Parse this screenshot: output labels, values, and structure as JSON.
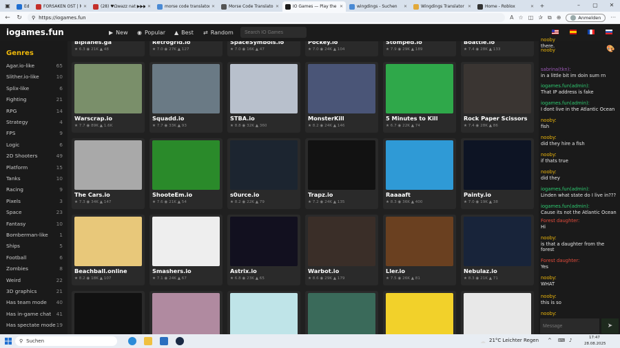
{
  "browser": {
    "tabs": [
      {
        "label": "Edge",
        "color": "#1f6fd1"
      },
      {
        "label": "FORSAKEN OST | M!:",
        "color": "#c4302b"
      },
      {
        "label": "(28) ♥Ωwazz nat ▶▶▶▶",
        "color": "#c4302b"
      },
      {
        "label": "morse code translator - S",
        "color": "#4a8ad4"
      },
      {
        "label": "Morse Code Translator | M",
        "color": "#555"
      },
      {
        "label": "IO Games — Play the Best",
        "color": "#1b1b1b"
      },
      {
        "label": "wingdings - Suchen",
        "color": "#4a8ad4"
      },
      {
        "label": "Wingdings Translator ⚙✍",
        "color": "#e2a93b"
      },
      {
        "label": "Home - Roblox",
        "color": "#333"
      }
    ],
    "url": "https://iogames.fun",
    "profile_label": "Anmelden"
  },
  "header": {
    "logo": "iogames.fun",
    "nav": [
      "New",
      "Popular",
      "Best",
      "Random"
    ],
    "search_placeholder": "Search IO Games"
  },
  "sidebar": {
    "title": "Genres",
    "categories": [
      {
        "name": "Agar.io-like",
        "count": "65"
      },
      {
        "name": "Slither.io-like",
        "count": "10"
      },
      {
        "name": "Splix-like",
        "count": "6"
      },
      {
        "name": "Fighting",
        "count": "21"
      },
      {
        "name": "RPG",
        "count": "14"
      },
      {
        "name": "Strategy",
        "count": "4"
      },
      {
        "name": "FPS",
        "count": "9"
      },
      {
        "name": "Logic",
        "count": "6"
      },
      {
        "name": "2D Shooters",
        "count": "49"
      },
      {
        "name": "Platform",
        "count": "15"
      },
      {
        "name": "Tanks",
        "count": "10"
      },
      {
        "name": "Racing",
        "count": "9"
      },
      {
        "name": "Pixels",
        "count": "3"
      },
      {
        "name": "Space",
        "count": "23"
      },
      {
        "name": "Fantasy",
        "count": "10"
      },
      {
        "name": "Bomberman-like",
        "count": "1"
      },
      {
        "name": "Ships",
        "count": "5"
      },
      {
        "name": "Football",
        "count": "6"
      },
      {
        "name": "Zombies",
        "count": "8"
      },
      {
        "name": "Weird",
        "count": "22"
      },
      {
        "name": "3D graphics",
        "count": "21"
      },
      {
        "name": "Has team mode",
        "count": "40"
      },
      {
        "name": "Has in-game chat",
        "count": "41"
      },
      {
        "name": "Has spectate mode",
        "count": "19"
      }
    ]
  },
  "games": [
    {
      "name": "Biplanes.ga",
      "rating": "6.3",
      "plays": "21K",
      "likes": "48",
      "color": "#6a8a9a"
    },
    {
      "name": "Retrogrid.io",
      "rating": "7.0",
      "plays": "27K",
      "likes": "127",
      "color": "#444"
    },
    {
      "name": "SpaceSymbols.io",
      "rating": "7.0",
      "plays": "16K",
      "likes": "47",
      "color": "#222"
    },
    {
      "name": "Pockey.io",
      "rating": "7.0",
      "plays": "24K",
      "likes": "104",
      "color": "#333"
    },
    {
      "name": "Stomped.io",
      "rating": "7.9",
      "plays": "29K",
      "likes": "189",
      "color": "#3a5"
    },
    {
      "name": "Boattle.io",
      "rating": "7.4",
      "plays": "28K",
      "likes": "133",
      "color": "#246"
    },
    {
      "name": "Warscrap.io",
      "rating": "7.7",
      "plays": "89K",
      "likes": "1.6K",
      "color": "#7a8f6a"
    },
    {
      "name": "Squadd.io",
      "rating": "7.7",
      "plays": "33K",
      "likes": "93",
      "color": "#6a7a85"
    },
    {
      "name": "STBA.io",
      "rating": "8.8",
      "plays": "32K",
      "likes": "360",
      "color": "#b8c0cc"
    },
    {
      "name": "MonsterKill",
      "rating": "8.2",
      "plays": "24K",
      "likes": "146",
      "color": "#4a5577"
    },
    {
      "name": "5 Minutes to Kill",
      "rating": "6.7",
      "plays": "22K",
      "likes": "74",
      "color": "#2fa84a"
    },
    {
      "name": "Rock Paper Scissors",
      "rating": "7.4",
      "plays": "28K",
      "likes": "86",
      "color": "#3a3532"
    },
    {
      "name": "The Cars.io",
      "rating": "7.3",
      "plays": "34K",
      "likes": "147",
      "color": "#a9a9a9"
    },
    {
      "name": "ShooteEm.io",
      "rating": "7.6",
      "plays": "21K",
      "likes": "54",
      "color": "#2a8a2a"
    },
    {
      "name": "s0urce.io",
      "rating": "8.2",
      "plays": "22K",
      "likes": "79",
      "color": "#1c2530"
    },
    {
      "name": "Trapz.io",
      "rating": "7.2",
      "plays": "24K",
      "likes": "135",
      "color": "#121212"
    },
    {
      "name": "Raaaaft",
      "rating": "8.3",
      "plays": "36K",
      "likes": "400",
      "color": "#2f9ad6"
    },
    {
      "name": "Painty.io",
      "rating": "7.0",
      "plays": "19K",
      "likes": "38",
      "color": "#0d1424"
    },
    {
      "name": "Beachball.online",
      "rating": "8.2",
      "plays": "18K",
      "likes": "107",
      "color": "#e8c87a"
    },
    {
      "name": "Smashers.io",
      "rating": "7.1",
      "plays": "24K",
      "likes": "67",
      "color": "#eeeeee"
    },
    {
      "name": "Astrix.io",
      "rating": "6.8",
      "plays": "23K",
      "likes": "65",
      "color": "#12101f"
    },
    {
      "name": "Warbot.io",
      "rating": "8.6",
      "plays": "29K",
      "likes": "179",
      "color": "#3a2e28"
    },
    {
      "name": "Ller.io",
      "rating": "7.5",
      "plays": "26K",
      "likes": "81",
      "color": "#6a4020"
    },
    {
      "name": "Nebulaz.io",
      "rating": "8.3",
      "plays": "21K",
      "likes": "71",
      "color": "#18243a"
    },
    {
      "name": "",
      "rating": "",
      "plays": "",
      "likes": "",
      "color": "#111111"
    },
    {
      "name": "",
      "rating": "",
      "plays": "",
      "likes": "",
      "color": "#b08aa0"
    },
    {
      "name": "",
      "rating": "",
      "plays": "",
      "likes": "",
      "color": "#bfe4e8"
    },
    {
      "name": "",
      "rating": "",
      "plays": "",
      "likes": "",
      "color": "#3a6a5a"
    },
    {
      "name": "",
      "rating": "",
      "plays": "",
      "likes": "",
      "color": "#f2d12a"
    },
    {
      "name": "",
      "rating": "",
      "plays": "",
      "likes": "",
      "color": "#e8e8e8"
    }
  ],
  "chat": {
    "messages": [
      {
        "user": "nooby",
        "text": "there.",
        "ucolor": "#f0b90b"
      },
      {
        "user": "nooby",
        "text": "",
        "ucolor": "#f0b90b"
      },
      {
        "user": "sabrina(tkn):",
        "text": "in a little bit im doin sum rn",
        "ucolor": "#9b59b6"
      },
      {
        "user": "iogames.fun(admin):",
        "text": "That IP address is fake",
        "ucolor": "#2ecc71"
      },
      {
        "user": "iogames.fun(admin):",
        "text": "I dont live in the Atlantic Ocean",
        "ucolor": "#2ecc71"
      },
      {
        "user": "nooby:",
        "text": "fish",
        "ucolor": "#f0b90b"
      },
      {
        "user": "nooby:",
        "text": "did they hire a fish",
        "ucolor": "#f0b90b"
      },
      {
        "user": "nooby:",
        "text": "if thats true",
        "ucolor": "#f0b90b"
      },
      {
        "user": "nooby:",
        "text": "did they",
        "ucolor": "#f0b90b"
      },
      {
        "user": "iogames.fun(admin):",
        "text": "Linden what state do I live in???",
        "ucolor": "#2ecc71"
      },
      {
        "user": "iogames.fun(admin):",
        "text": "Cause its not the Atlantic Ocean",
        "ucolor": "#2ecc71"
      },
      {
        "user": "Forest daughter:",
        "text": "Hi",
        "ucolor": "#e74c3c"
      },
      {
        "user": "nooby:",
        "text": "is that a daughter from the forest",
        "ucolor": "#f0b90b"
      },
      {
        "user": "Forest daughter:",
        "text": "Yes",
        "ucolor": "#e74c3c"
      },
      {
        "user": "nooby:",
        "text": "WHAT",
        "ucolor": "#f0b90b"
      },
      {
        "user": "nooby:",
        "text": "this is so",
        "ucolor": "#f0b90b"
      },
      {
        "user": "nooby:",
        "text": "",
        "ucolor": "#f0b90b"
      }
    ],
    "input_placeholder": "Message"
  },
  "taskbar": {
    "search_label": "Suchen",
    "weather": "21°C Leichter Regen",
    "time": "17:47",
    "date": "28.08.2025"
  }
}
